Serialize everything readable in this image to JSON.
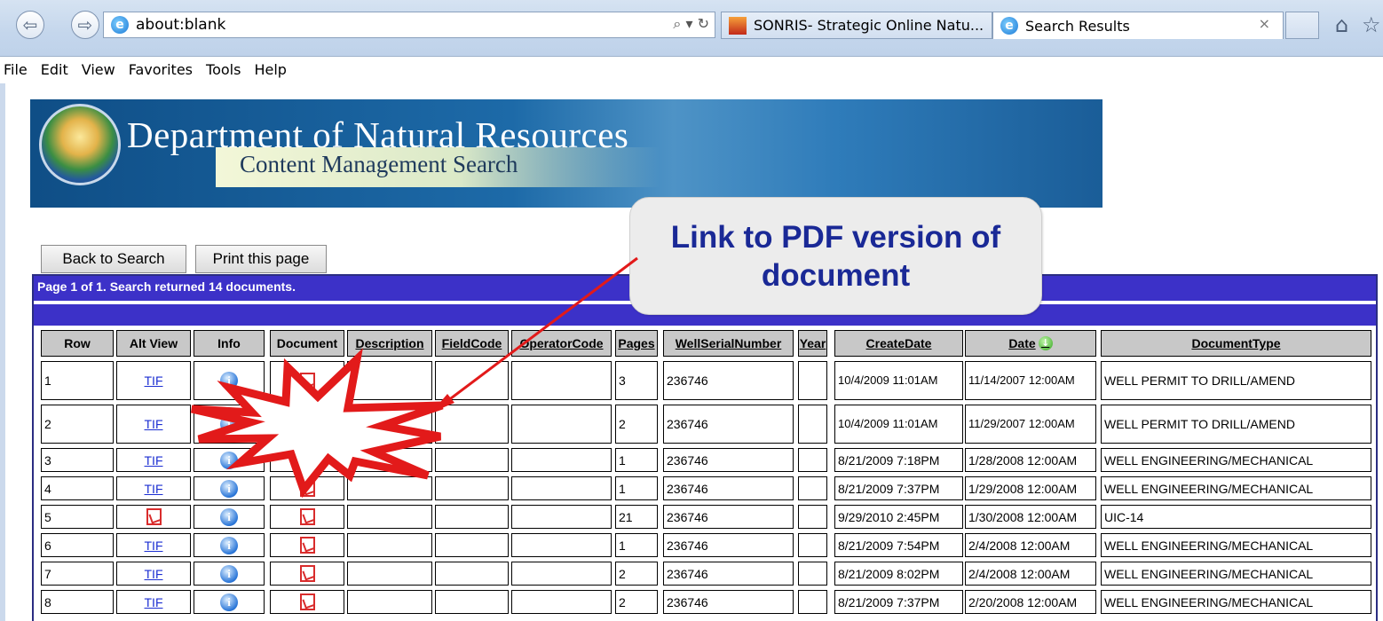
{
  "browser": {
    "address": "about:blank",
    "address_controls": "⌕ ▾ ↻",
    "tabs": [
      {
        "label": "SONRIS- Strategic Online Natu..."
      },
      {
        "label": "Search Results"
      }
    ],
    "tab_close": "×",
    "menu": [
      "File",
      "Edit",
      "View",
      "Favorites",
      "Tools",
      "Help"
    ]
  },
  "banner": {
    "title": "Department of Natural Resources",
    "subtitle": "Content Management Search"
  },
  "buttons": {
    "back": "Back to Search",
    "print": "Print this page"
  },
  "results": {
    "summary": "Page 1 of 1. Search returned 14 documents.",
    "columns": [
      "Row",
      "Alt View",
      "Info",
      "Document",
      "Description",
      "FieldCode",
      "OperatorCode",
      "Pages",
      "WellSerialNumber",
      "Year",
      "CreateDate",
      "Date",
      "DocumentType"
    ],
    "rows": [
      {
        "row": "1",
        "alt": "TIF",
        "pages": "3",
        "well": "236746",
        "create": "10/4/2009 11:01AM",
        "date": "11/14/2007 12:00AM",
        "type": "WELL PERMIT TO DRILL/AMEND"
      },
      {
        "row": "2",
        "alt": "TIF",
        "pages": "2",
        "well": "236746",
        "create": "10/4/2009 11:01AM",
        "date": "11/29/2007 12:00AM",
        "type": "WELL PERMIT TO DRILL/AMEND"
      },
      {
        "row": "3",
        "alt": "TIF",
        "pages": "1",
        "well": "236746",
        "create": "8/21/2009 7:18PM",
        "date": "1/28/2008 12:00AM",
        "type": "WELL ENGINEERING/MECHANICAL"
      },
      {
        "row": "4",
        "alt": "TIF",
        "pages": "1",
        "well": "236746",
        "create": "8/21/2009 7:37PM",
        "date": "1/29/2008 12:00AM",
        "type": "WELL ENGINEERING/MECHANICAL"
      },
      {
        "row": "5",
        "alt": "",
        "pages": "21",
        "well": "236746",
        "create": "9/29/2010 2:45PM",
        "date": "1/30/2008 12:00AM",
        "type": "UIC-14"
      },
      {
        "row": "6",
        "alt": "TIF",
        "pages": "1",
        "well": "236746",
        "create": "8/21/2009 7:54PM",
        "date": "2/4/2008 12:00AM",
        "type": "WELL ENGINEERING/MECHANICAL"
      },
      {
        "row": "7",
        "alt": "TIF",
        "pages": "2",
        "well": "236746",
        "create": "8/21/2009 8:02PM",
        "date": "2/4/2008 12:00AM",
        "type": "WELL ENGINEERING/MECHANICAL"
      },
      {
        "row": "8",
        "alt": "TIF",
        "pages": "2",
        "well": "236746",
        "create": "8/21/2009 7:37PM",
        "date": "2/20/2008 12:00AM",
        "type": "WELL ENGINEERING/MECHANICAL"
      }
    ]
  },
  "callout": {
    "text": "Link to PDF version of document"
  },
  "colors": {
    "header_bar": "#3c31c8",
    "callout_text": "#1a2996",
    "annotation": "#e21a1a",
    "link": "#1c2fd2"
  }
}
